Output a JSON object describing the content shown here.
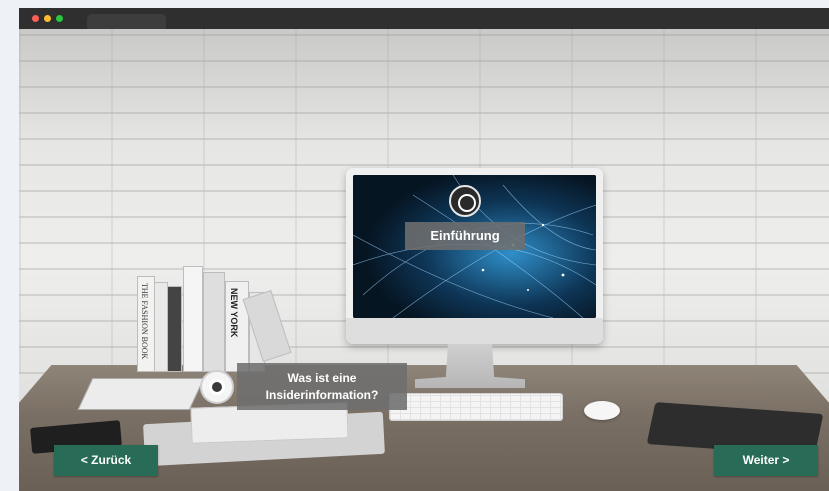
{
  "browser": {
    "window_controls": [
      "close",
      "minimize",
      "maximize"
    ],
    "colors": {
      "close": "#ff5f57",
      "minimize": "#febc2e",
      "maximize": "#28c840"
    }
  },
  "hotspots": {
    "intro": {
      "label": "Einführung",
      "icon": "target-icon"
    },
    "insider": {
      "label": "Was ist eine Insiderinformation?",
      "icon": "target-icon"
    }
  },
  "navigation": {
    "back_label": "< Zurück",
    "next_label": "Weiter >",
    "accent_color": "#286b56"
  },
  "books": {
    "spine_texts": [
      "THE FASHION BOOK",
      "NEW YORK"
    ]
  }
}
